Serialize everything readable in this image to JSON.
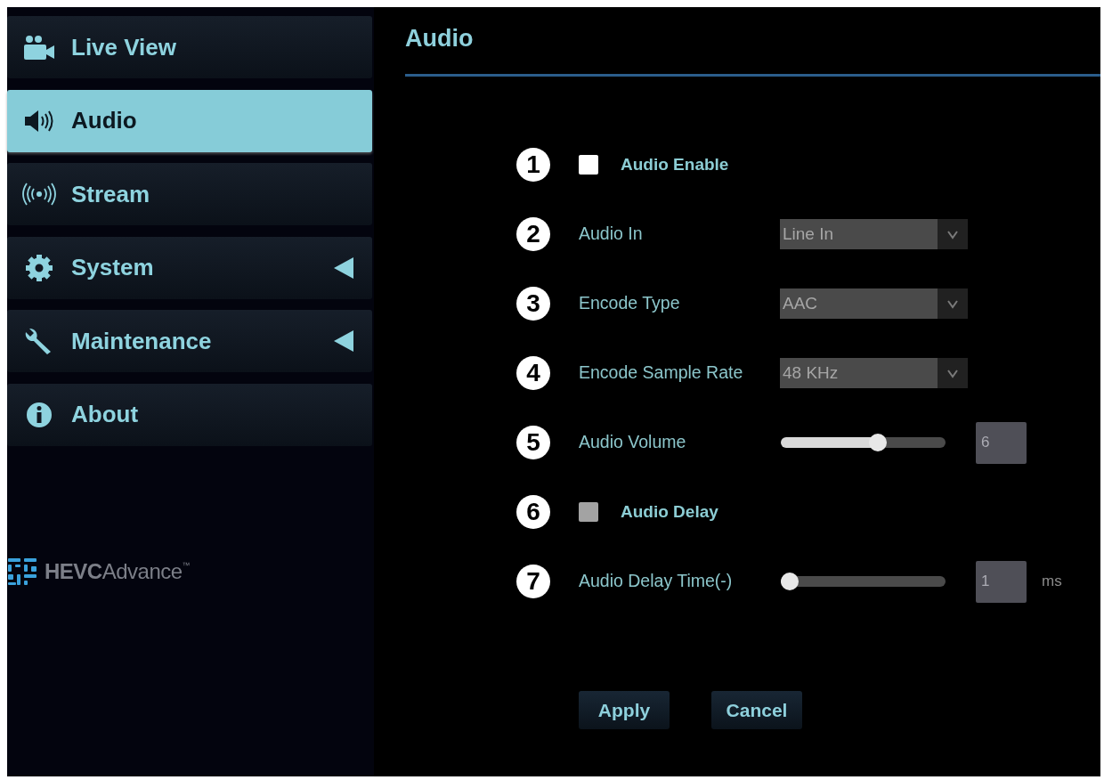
{
  "sidebar": {
    "items": [
      {
        "label": "Live View",
        "selected": false,
        "expandable": false
      },
      {
        "label": "Audio",
        "selected": true,
        "expandable": false
      },
      {
        "label": "Stream",
        "selected": false,
        "expandable": false
      },
      {
        "label": "System",
        "selected": false,
        "expandable": true
      },
      {
        "label": "Maintenance",
        "selected": false,
        "expandable": true
      },
      {
        "label": "About",
        "selected": false,
        "expandable": false
      }
    ],
    "logo": {
      "text": "**HEVC**Advance$^{™}$"
    }
  },
  "page": {
    "title": "Audio"
  },
  "fields": [
    {
      "marker": "1",
      "kind": "checkbox",
      "label": "Audio Enable",
      "checked": false,
      "disabled": false
    },
    {
      "marker": "2",
      "kind": "select",
      "label": "Audio In",
      "value": "Line In",
      "disabled": true
    },
    {
      "marker": "3",
      "kind": "select",
      "label": "Encode Type",
      "value": "AAC",
      "disabled": true
    },
    {
      "marker": "4",
      "kind": "select",
      "label": "Encode Sample Rate",
      "value": "48 KHz",
      "disabled": true
    },
    {
      "marker": "5",
      "kind": "slider",
      "label": "Audio Volume",
      "level": 0.6,
      "value": "6",
      "disabled": true
    },
    {
      "marker": "6",
      "kind": "checkbox",
      "label": "Audio Delay",
      "checked": false,
      "disabled": true
    },
    {
      "marker": "7",
      "kind": "slider",
      "label": "Audio Delay Time(-)",
      "level": 0,
      "value": "1",
      "unit": "ms",
      "disabled": true
    }
  ],
  "buttons": [
    "Apply",
    "Cancel"
  ]
}
